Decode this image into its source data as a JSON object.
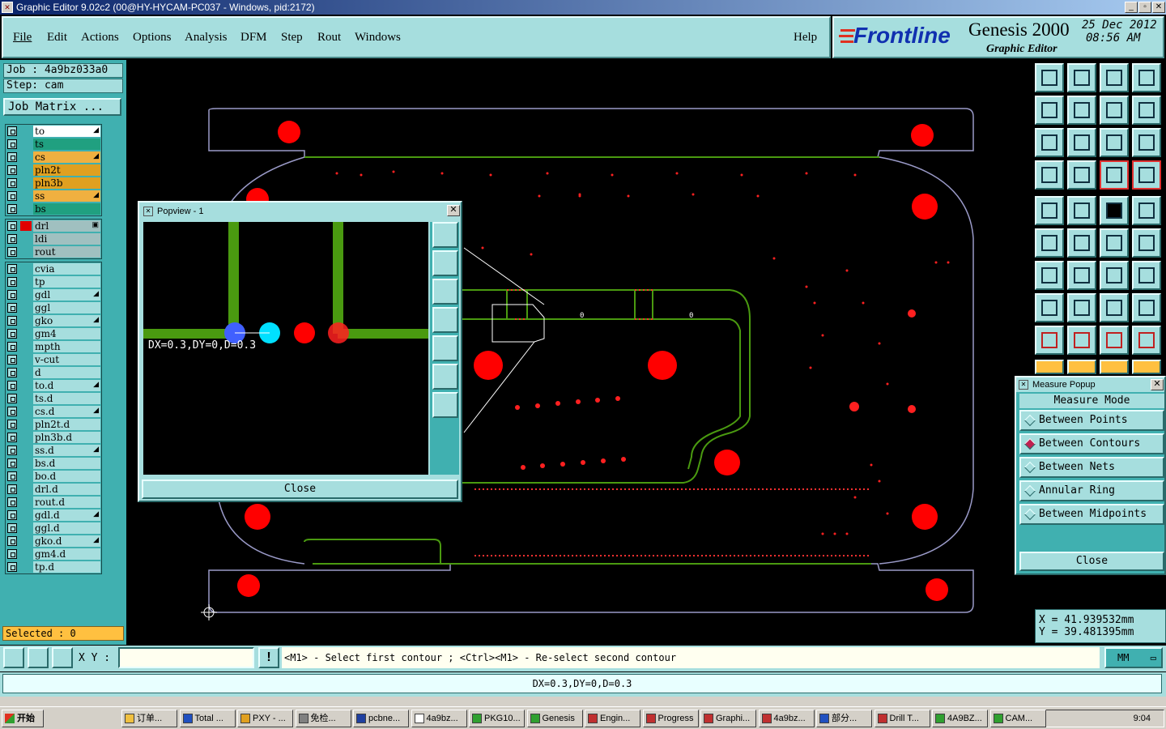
{
  "window": {
    "title": "Graphic Editor 9.02c2 (00@HY-HYCAM-PC037 - Windows, pid:2172)"
  },
  "menu": {
    "items": [
      "File",
      "Edit",
      "Actions",
      "Options",
      "Analysis",
      "DFM",
      "Step",
      "Rout",
      "Windows"
    ],
    "help": "Help"
  },
  "brand": {
    "logo": "Frontline",
    "product": "Genesis 2000",
    "subtitle": "Graphic Editor",
    "date": "25 Dec 2012",
    "time": "08:56 AM"
  },
  "job": {
    "job_label": "Job : 4a9bz033a0",
    "step_label": "Step: cam",
    "matrix_button": "Job Matrix ..."
  },
  "layers": {
    "board": [
      {
        "name": "to",
        "color": "#ffffff",
        "mark": "◢"
      },
      {
        "name": "ts",
        "color": "#20a080",
        "mark": ""
      },
      {
        "name": "cs",
        "color": "#f0b040",
        "mark": "◢"
      },
      {
        "name": "pln2t",
        "color": "#e0a020",
        "mark": ""
      },
      {
        "name": "pln3b",
        "color": "#e0a020",
        "mark": ""
      },
      {
        "name": "ss",
        "color": "#f0b040",
        "mark": "◢"
      },
      {
        "name": "bs",
        "color": "#20a080",
        "mark": ""
      }
    ],
    "drill": [
      {
        "name": "drl",
        "color": "#a0c0c0",
        "mark": "▣"
      },
      {
        "name": "ldi",
        "color": "#a0c0c0",
        "mark": ""
      },
      {
        "name": "rout",
        "color": "#a0c0c0",
        "mark": ""
      }
    ],
    "misc": [
      {
        "name": "cvia",
        "mark": ""
      },
      {
        "name": "tp",
        "mark": ""
      },
      {
        "name": "gdl",
        "mark": "◢"
      },
      {
        "name": "ggl",
        "mark": ""
      },
      {
        "name": "gko",
        "mark": "◢"
      },
      {
        "name": "gm4",
        "mark": ""
      },
      {
        "name": "mpth",
        "mark": ""
      },
      {
        "name": "v-cut",
        "mark": ""
      },
      {
        "name": "d",
        "mark": ""
      },
      {
        "name": "to.d",
        "mark": "◢"
      },
      {
        "name": "ts.d",
        "mark": ""
      },
      {
        "name": "cs.d",
        "mark": "◢"
      },
      {
        "name": "pln2t.d",
        "mark": ""
      },
      {
        "name": "pln3b.d",
        "mark": ""
      },
      {
        "name": "ss.d",
        "mark": "◢"
      },
      {
        "name": "bs.d",
        "mark": ""
      },
      {
        "name": "bo.d",
        "mark": ""
      },
      {
        "name": "drl.d",
        "mark": ""
      },
      {
        "name": "rout.d",
        "mark": ""
      },
      {
        "name": "gdl.d",
        "mark": "◢"
      },
      {
        "name": "ggl.d",
        "mark": ""
      },
      {
        "name": "gko.d",
        "mark": "◢"
      },
      {
        "name": "gm4.d",
        "mark": ""
      },
      {
        "name": "tp.d",
        "mark": ""
      }
    ]
  },
  "selected": "Selected : 0",
  "popview": {
    "title": "Popview - 1",
    "measurement": "DX=0.3,DY=0,D=0.3",
    "close": "Close"
  },
  "measure_popup": {
    "title": "Measure Popup",
    "heading": "Measure Mode",
    "options": [
      "Between Points",
      "Between Contours",
      "Between Nets",
      "Annular Ring",
      "Between Midpoints"
    ],
    "selected_option": "Between Contours",
    "close": "Close"
  },
  "coords": {
    "x": "X  =  41.939532mm",
    "y": "Y  =  39.481395mm"
  },
  "command": {
    "xy_label": "X Y :",
    "xy_value": "",
    "prompt": "<M1> - Select first contour ; <Ctrl><M1> - Re-select second contour",
    "units": "MM"
  },
  "status": {
    "text": "DX=0.3,DY=0,D=0.3"
  },
  "taskbar": {
    "start": "开始",
    "tasks": [
      "订单...",
      "Total ...",
      "PXY - ...",
      "免检...",
      "pcbne...",
      "4a9bz...",
      "PKG10...",
      "Genesis",
      "Engin...",
      "Progress",
      "Graphi...",
      "4a9bz...",
      "部分...",
      "Drill T...",
      "4A9BZ...",
      "CAM..."
    ],
    "clock": "9:04"
  },
  "colors": {
    "teal": "#40b0b0",
    "panel": "#a6dede",
    "pad": "#ff0000",
    "rout": "#4a9a10",
    "outline": "#9a9ac8"
  }
}
